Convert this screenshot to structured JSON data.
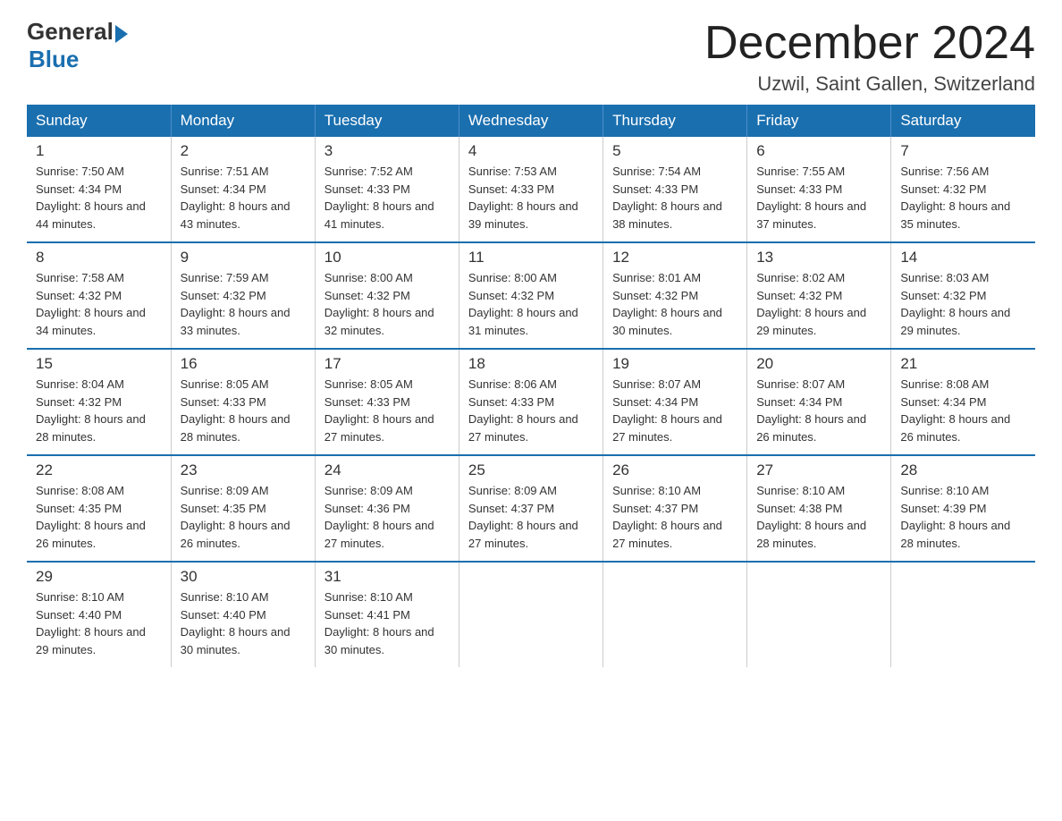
{
  "header": {
    "logo_general": "General",
    "logo_blue": "Blue",
    "month_year": "December 2024",
    "location": "Uzwil, Saint Gallen, Switzerland"
  },
  "days_of_week": [
    "Sunday",
    "Monday",
    "Tuesday",
    "Wednesday",
    "Thursday",
    "Friday",
    "Saturday"
  ],
  "weeks": [
    [
      {
        "day": "1",
        "sunrise": "7:50 AM",
        "sunset": "4:34 PM",
        "daylight": "8 hours and 44 minutes."
      },
      {
        "day": "2",
        "sunrise": "7:51 AM",
        "sunset": "4:34 PM",
        "daylight": "8 hours and 43 minutes."
      },
      {
        "day": "3",
        "sunrise": "7:52 AM",
        "sunset": "4:33 PM",
        "daylight": "8 hours and 41 minutes."
      },
      {
        "day": "4",
        "sunrise": "7:53 AM",
        "sunset": "4:33 PM",
        "daylight": "8 hours and 39 minutes."
      },
      {
        "day": "5",
        "sunrise": "7:54 AM",
        "sunset": "4:33 PM",
        "daylight": "8 hours and 38 minutes."
      },
      {
        "day": "6",
        "sunrise": "7:55 AM",
        "sunset": "4:33 PM",
        "daylight": "8 hours and 37 minutes."
      },
      {
        "day": "7",
        "sunrise": "7:56 AM",
        "sunset": "4:32 PM",
        "daylight": "8 hours and 35 minutes."
      }
    ],
    [
      {
        "day": "8",
        "sunrise": "7:58 AM",
        "sunset": "4:32 PM",
        "daylight": "8 hours and 34 minutes."
      },
      {
        "day": "9",
        "sunrise": "7:59 AM",
        "sunset": "4:32 PM",
        "daylight": "8 hours and 33 minutes."
      },
      {
        "day": "10",
        "sunrise": "8:00 AM",
        "sunset": "4:32 PM",
        "daylight": "8 hours and 32 minutes."
      },
      {
        "day": "11",
        "sunrise": "8:00 AM",
        "sunset": "4:32 PM",
        "daylight": "8 hours and 31 minutes."
      },
      {
        "day": "12",
        "sunrise": "8:01 AM",
        "sunset": "4:32 PM",
        "daylight": "8 hours and 30 minutes."
      },
      {
        "day": "13",
        "sunrise": "8:02 AM",
        "sunset": "4:32 PM",
        "daylight": "8 hours and 29 minutes."
      },
      {
        "day": "14",
        "sunrise": "8:03 AM",
        "sunset": "4:32 PM",
        "daylight": "8 hours and 29 minutes."
      }
    ],
    [
      {
        "day": "15",
        "sunrise": "8:04 AM",
        "sunset": "4:32 PM",
        "daylight": "8 hours and 28 minutes."
      },
      {
        "day": "16",
        "sunrise": "8:05 AM",
        "sunset": "4:33 PM",
        "daylight": "8 hours and 28 minutes."
      },
      {
        "day": "17",
        "sunrise": "8:05 AM",
        "sunset": "4:33 PM",
        "daylight": "8 hours and 27 minutes."
      },
      {
        "day": "18",
        "sunrise": "8:06 AM",
        "sunset": "4:33 PM",
        "daylight": "8 hours and 27 minutes."
      },
      {
        "day": "19",
        "sunrise": "8:07 AM",
        "sunset": "4:34 PM",
        "daylight": "8 hours and 27 minutes."
      },
      {
        "day": "20",
        "sunrise": "8:07 AM",
        "sunset": "4:34 PM",
        "daylight": "8 hours and 26 minutes."
      },
      {
        "day": "21",
        "sunrise": "8:08 AM",
        "sunset": "4:34 PM",
        "daylight": "8 hours and 26 minutes."
      }
    ],
    [
      {
        "day": "22",
        "sunrise": "8:08 AM",
        "sunset": "4:35 PM",
        "daylight": "8 hours and 26 minutes."
      },
      {
        "day": "23",
        "sunrise": "8:09 AM",
        "sunset": "4:35 PM",
        "daylight": "8 hours and 26 minutes."
      },
      {
        "day": "24",
        "sunrise": "8:09 AM",
        "sunset": "4:36 PM",
        "daylight": "8 hours and 27 minutes."
      },
      {
        "day": "25",
        "sunrise": "8:09 AM",
        "sunset": "4:37 PM",
        "daylight": "8 hours and 27 minutes."
      },
      {
        "day": "26",
        "sunrise": "8:10 AM",
        "sunset": "4:37 PM",
        "daylight": "8 hours and 27 minutes."
      },
      {
        "day": "27",
        "sunrise": "8:10 AM",
        "sunset": "4:38 PM",
        "daylight": "8 hours and 28 minutes."
      },
      {
        "day": "28",
        "sunrise": "8:10 AM",
        "sunset": "4:39 PM",
        "daylight": "8 hours and 28 minutes."
      }
    ],
    [
      {
        "day": "29",
        "sunrise": "8:10 AM",
        "sunset": "4:40 PM",
        "daylight": "8 hours and 29 minutes."
      },
      {
        "day": "30",
        "sunrise": "8:10 AM",
        "sunset": "4:40 PM",
        "daylight": "8 hours and 30 minutes."
      },
      {
        "day": "31",
        "sunrise": "8:10 AM",
        "sunset": "4:41 PM",
        "daylight": "8 hours and 30 minutes."
      },
      null,
      null,
      null,
      null
    ]
  ],
  "labels": {
    "sunrise_prefix": "Sunrise: ",
    "sunset_prefix": "Sunset: ",
    "daylight_prefix": "Daylight: "
  }
}
